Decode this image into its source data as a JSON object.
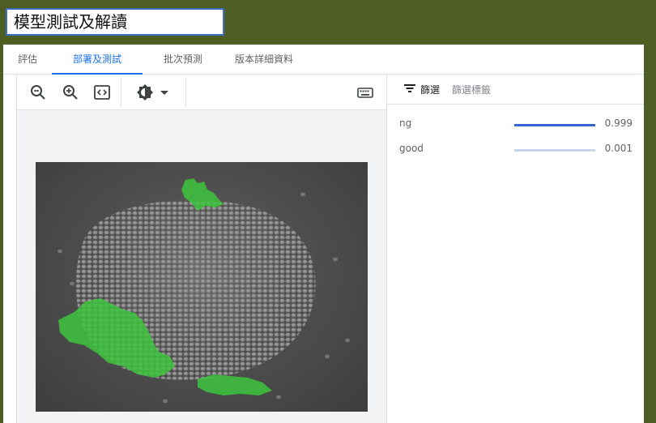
{
  "window": {
    "title": "模型測試及解讀"
  },
  "tabs": [
    {
      "label": "評估",
      "active": false
    },
    {
      "label": "部署及測試",
      "active": true
    },
    {
      "label": "批次預測",
      "active": false
    },
    {
      "label": "版本詳細資料",
      "active": false
    }
  ],
  "toolbar": {
    "icons": [
      "zoom-out-icon",
      "zoom-in-icon",
      "fit-to-screen-icon",
      "brightness-icon",
      "dropdown-arrow-icon",
      "keyboard-icon"
    ]
  },
  "filter": {
    "label": "篩選",
    "sub_label": "篩選標籤"
  },
  "predictions": [
    {
      "label": "ng",
      "value": "0.999",
      "score": 0.999
    },
    {
      "label": "good",
      "value": "0.001",
      "score": 0.001
    }
  ],
  "colors": {
    "accent": "#1a73e8",
    "bar_fill": "#3367d6",
    "bar_track": "#c6d4ec",
    "overlay": "#3ec43e",
    "background": "#4e5e22"
  }
}
